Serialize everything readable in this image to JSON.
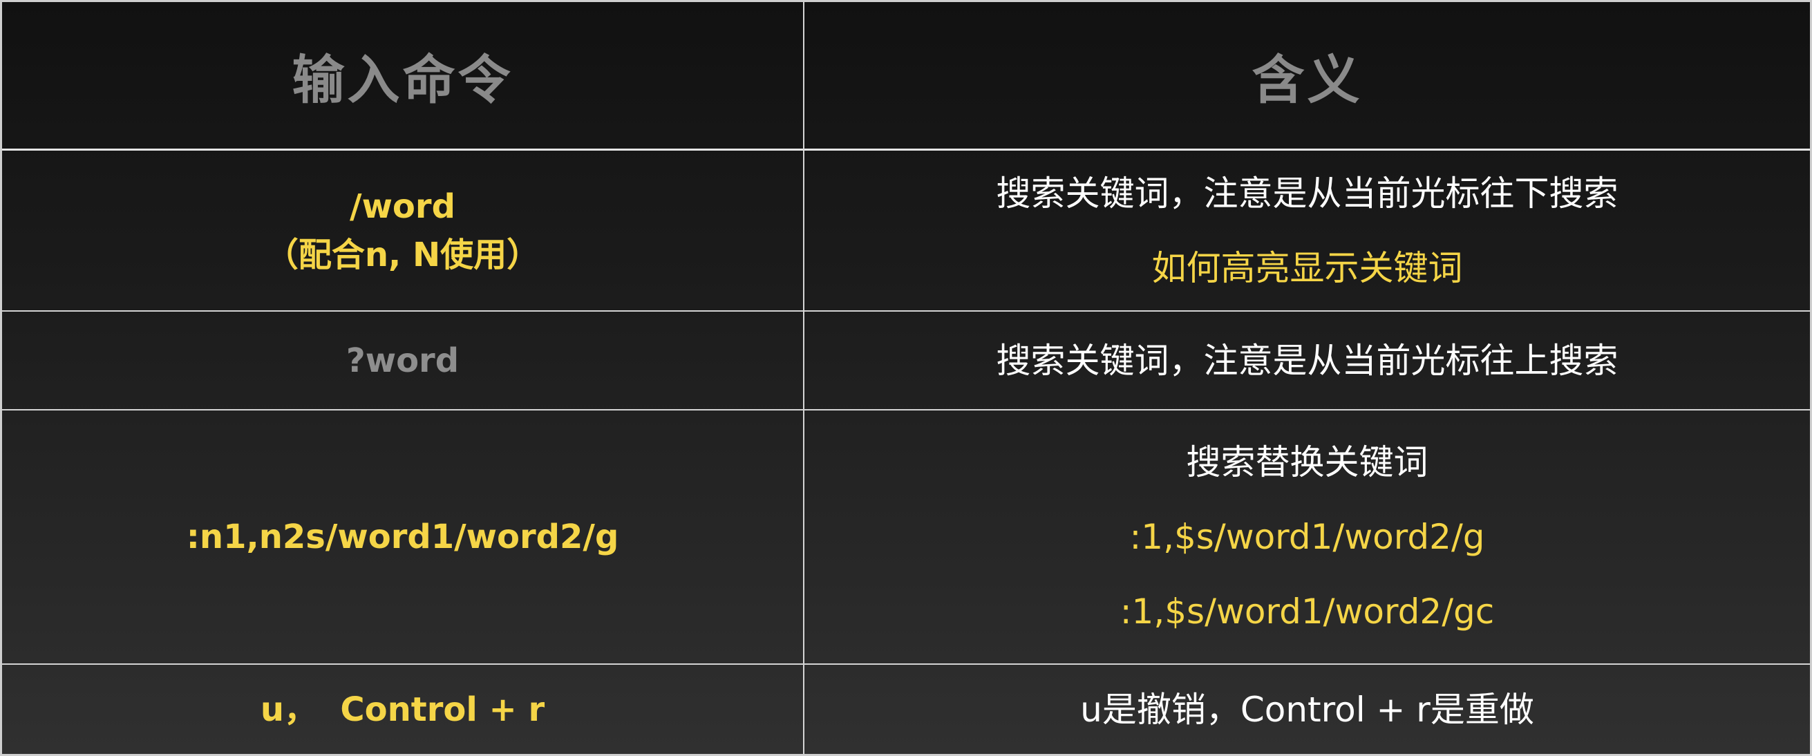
{
  "header": {
    "col_command": "输入命令",
    "col_meaning": "含义"
  },
  "rows": [
    {
      "command_lines": [
        "/word",
        "（配合n, N使用）"
      ],
      "meaning_lines": [
        "搜索关键词，注意是从当前光标往下搜索",
        "如何高亮显示关键词"
      ]
    },
    {
      "command_lines": [
        "?word"
      ],
      "meaning_lines": [
        "搜索关键词，注意是从当前光标往上搜索"
      ]
    },
    {
      "command_lines": [
        ":n1,n2s/word1/word2/g"
      ],
      "meaning_lines": [
        "搜索替换关键词",
        ":1,$s/word1/word2/g",
        ":1,$s/word1/word2/gc"
      ]
    },
    {
      "command_lines": [
        "u，  Control + r"
      ],
      "meaning_lines": [
        "u是撤销，Control + r是重做"
      ]
    }
  ],
  "colors": {
    "highlight": "#f5d547",
    "muted": "#8e8e8e",
    "text": "#ffffff",
    "border": "#d4d4d4",
    "background_top": "#111111",
    "background_bottom": "#303030"
  }
}
